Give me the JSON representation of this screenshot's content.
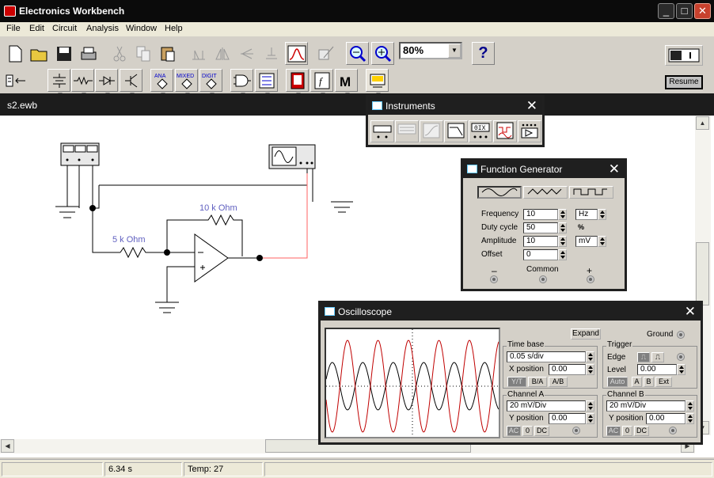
{
  "app": {
    "title": "Electronics Workbench"
  },
  "menu": [
    "File",
    "Edit",
    "Circuit",
    "Analysis",
    "Window",
    "Help"
  ],
  "toolbar": {
    "zoom": "80%",
    "help": "?",
    "resume": "Resume",
    "ana": "ANA",
    "mixed": "MIXED",
    "digit": "DIGIT",
    "f": "f",
    "m": "M"
  },
  "document": {
    "title": "s2.ewb"
  },
  "circuit": {
    "r1": "10 k Ohm",
    "r2": "5 k Ohm"
  },
  "instruments": {
    "title": "Instruments",
    "dmm": "0IX"
  },
  "funcgen": {
    "title": "Function Generator",
    "rows": [
      {
        "label": "Frequency",
        "value": "10",
        "unit": "Hz"
      },
      {
        "label": "Duty cycle",
        "value": "50",
        "unit": "%"
      },
      {
        "label": "Amplitude",
        "value": "10",
        "unit": "mV"
      },
      {
        "label": "Offset",
        "value": "0",
        "unit": ""
      }
    ],
    "minus": "–",
    "common": "Common",
    "plus": "+"
  },
  "scope": {
    "title": "Oscilloscope",
    "expand": "Expand",
    "ground": "Ground",
    "timebase_label": "Time base",
    "timebase": "0.05 s/div",
    "xpos_label": "X position",
    "xpos": "0.00",
    "yt": "Y/T",
    "ba": "B/A",
    "ab": "A/B",
    "trigger_label": "Trigger",
    "edge_label": "Edge",
    "level_label": "Level",
    "level": "0.00",
    "auto": "Auto",
    "a": "A",
    "b": "B",
    "ext": "Ext",
    "cha_label": "Channel A",
    "cha_scale": "20 mV/Div",
    "cha_ypos_label": "Y position",
    "cha_ypos": "0.00",
    "chb_label": "Channel B",
    "chb_scale": "20 mV/Div",
    "chb_ypos_label": "Y position",
    "chb_ypos": "0.00",
    "ac": "AC",
    "zero": "0",
    "dc": "DC"
  },
  "status": {
    "time": "6.34 s",
    "temp": "Temp:  27"
  },
  "colors": {
    "trace_a": "#000000",
    "trace_b": "#c00000",
    "wire": "#000000",
    "red_wire": "#ff6060",
    "component_label": "#6060c0"
  }
}
